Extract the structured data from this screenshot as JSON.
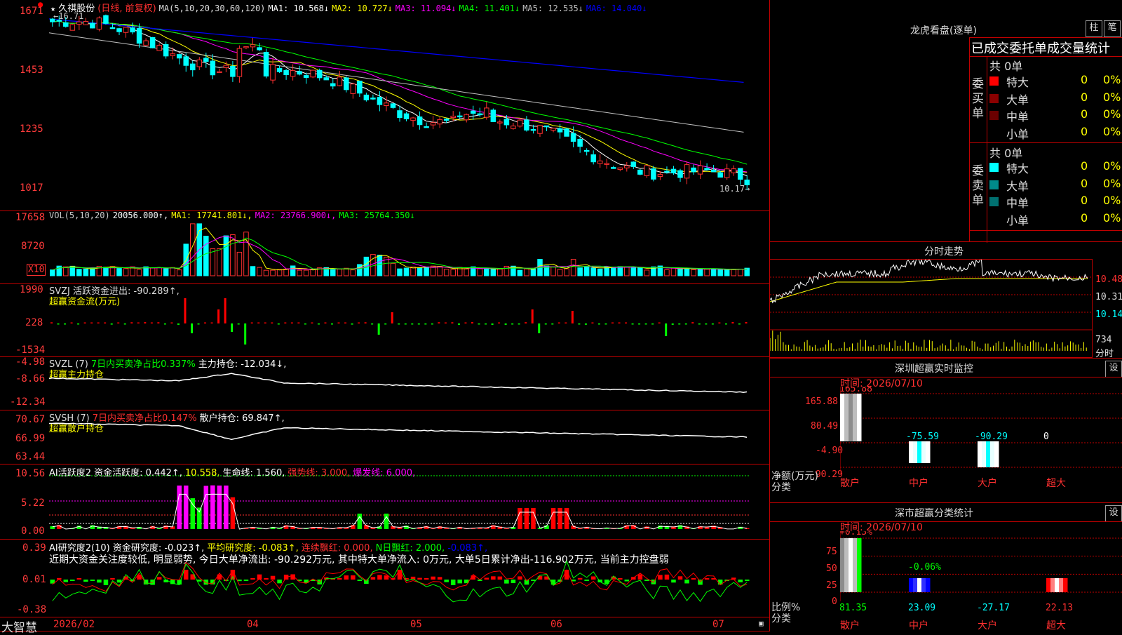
{
  "stock": {
    "name": "久祺股份",
    "period": "(日线, 前复权)",
    "star_icon": "star-icon",
    "high_label": "16.71",
    "low_label": "10.17"
  },
  "ma_legend": {
    "prefix": "MA(5,10,20,30,60,120)",
    "items": [
      {
        "text": "MA1: 10.568↓",
        "color": "#ffffff"
      },
      {
        "text": "MA2: 10.727↓",
        "color": "#ffff00"
      },
      {
        "text": "MA3: 11.094↓",
        "color": "#ff00ff"
      },
      {
        "text": "MA4: 11.401↓",
        "color": "#00ff00"
      },
      {
        "text": "MA5: 12.535↓",
        "color": "#c0c0c0"
      },
      {
        "text": "MA6: 14.040↓",
        "color": "#0000ff"
      }
    ]
  },
  "price_axis": [
    "1671",
    "1453",
    "1235",
    "1017"
  ],
  "vol_legend": {
    "items": [
      {
        "text": "VOL(5,10,20)",
        "color": "#cccccc"
      },
      {
        "text": "20056.000↑,",
        "color": "#ffffff"
      },
      {
        "text": "MA1: 17741.801↓,",
        "color": "#ffff00"
      },
      {
        "text": "MA2: 23766.900↓,",
        "color": "#ff00ff"
      },
      {
        "text": "MA3: 25764.350↓",
        "color": "#00ff00"
      }
    ]
  },
  "vol_axis": [
    "17658",
    "8720",
    "X10"
  ],
  "svzj": {
    "line1": "SVZJ  活跃资金进出: -90.289↑,",
    "line2": "超赢资金流(万元)",
    "axis": [
      "1990",
      "228",
      "-1534"
    ]
  },
  "svzl": {
    "label": "SVZL (7)",
    "green": "7日内买卖净占比0.337%",
    "white": "主力持仓: -12.034↓,",
    "line2": "超赢主力持仓",
    "axis": [
      "-4.98",
      "-8.66",
      "-12.34"
    ]
  },
  "svsh": {
    "label": "SVSH (7)",
    "red": "7日内买卖净占比0.147%",
    "white": "散户持仓: 69.847↑,",
    "line2": "超赢散户持仓",
    "axis": [
      "70.67",
      "66.99",
      "63.44"
    ]
  },
  "ai_active": {
    "prefix": "AI活跃度2 资金活跃度: 0.442↑,",
    "val2": "10.558,",
    "life": "生命线: 1.560,",
    "strong": "强势线: 3.000,",
    "burst": "爆发线: 6.000,",
    "axis": [
      "10.56",
      "5.22",
      "0.00"
    ]
  },
  "ai_research": {
    "prefix": "AI研究度2(10) 资金研究度: -0.023↑,",
    "avg": "平均研究度: -0.083↑,",
    "cont": "连续飘红: 0.000,",
    "nday": "N日飘红: 2.000,",
    "last": "-0.083↑,",
    "summary": "近期大资金关注度较低, 明显弱势, 今日大单净流出: -90.292万元, 其中特大单净流入: 0万元, 大单5日累计净出-116.902万元, 当前主力控盘弱",
    "axis": [
      "0.39",
      "0.01",
      "-0.38"
    ]
  },
  "time_axis": [
    "2026/02",
    "04",
    "05",
    "06",
    "07"
  ],
  "brand": "大智慧",
  "dragon": {
    "title": "龙虎看盘(逐单)",
    "btn1": "柱",
    "btn2": "笔",
    "subtitle": "已成交委托单成交量统计",
    "buy": {
      "label": "委买单",
      "total": "共 0单",
      "rows": [
        {
          "name": "特大",
          "color": "#ff0000",
          "n": "0",
          "pct": "0%"
        },
        {
          "name": "大单",
          "color": "#8b0000",
          "n": "0",
          "pct": "0%"
        },
        {
          "name": "中单",
          "color": "#6a0000",
          "n": "0",
          "pct": "0%"
        },
        {
          "name": "小单",
          "color": "",
          "n": "0",
          "pct": "0%"
        }
      ]
    },
    "sell": {
      "label": "委卖单",
      "total": "共 0单",
      "rows": [
        {
          "name": "特大",
          "color": "#00ffff",
          "n": "0",
          "pct": "0%"
        },
        {
          "name": "大单",
          "color": "#008b8b",
          "n": "0",
          "pct": "0%"
        },
        {
          "name": "中单",
          "color": "#007070",
          "n": "0",
          "pct": "0%"
        },
        {
          "name": "小单",
          "color": "",
          "n": "0",
          "pct": "0%"
        }
      ]
    }
  },
  "intraday": {
    "title": "分时走势",
    "axis": [
      "10.48",
      "10.31",
      "10.14"
    ],
    "vol": "734",
    "unit": "分时"
  },
  "sz_monitor": {
    "title": "深圳超赢实时监控",
    "btn": "设",
    "time": "时间: 2026/07/10",
    "axis": [
      "165.88",
      "80.49",
      "-4.90",
      "-90.29"
    ],
    "ylabel": "净额(万元)",
    "xlabel": "分类",
    "cats": [
      "散户",
      "中户",
      "大户",
      "超大"
    ],
    "values": [
      "165.88",
      "-75.59",
      "-90.29",
      "0"
    ]
  },
  "sz_class": {
    "title": "深市超赢分类统计",
    "btn": "设",
    "time": "时间: 2026/07/10",
    "axis": [
      "75",
      "50",
      "25",
      "0"
    ],
    "ylabel": "比例%",
    "xlabel": "分类",
    "cats": [
      "散户",
      "中户",
      "大户",
      "超大"
    ],
    "top": [
      "+0.13%",
      "-0.06%"
    ],
    "values": [
      "81.35",
      "23.09",
      "-27.17",
      "22.13"
    ]
  },
  "chart_data": [
    {
      "type": "candlestick",
      "title": "久祺股份 (日线, 前复权)",
      "series": [
        {
          "name": "MA1",
          "values": [
            10.568
          ]
        },
        {
          "name": "MA2",
          "values": [
            10.727
          ]
        },
        {
          "name": "MA3",
          "values": [
            11.094
          ]
        },
        {
          "name": "MA4",
          "values": [
            11.401
          ]
        },
        {
          "name": "MA5",
          "values": [
            12.535
          ]
        },
        {
          "name": "MA6",
          "values": [
            14.04
          ]
        }
      ],
      "annotations": [
        "16.71",
        "10.17"
      ],
      "ylim": [
        10.17,
        16.71
      ]
    },
    {
      "type": "bar",
      "title": "VOL(5,10,20)",
      "values": [
        20056.0
      ],
      "series": [
        {
          "name": "MA1",
          "values": [
            17741.801
          ]
        },
        {
          "name": "MA2",
          "values": [
            23766.9
          ]
        },
        {
          "name": "MA3",
          "values": [
            25764.35
          ]
        }
      ]
    },
    {
      "type": "bar",
      "title": "SVZJ 活跃资金进出",
      "values": [
        -90.289
      ],
      "ylim": [
        -1534,
        1990
      ]
    },
    {
      "type": "line",
      "title": "SVZL 主力持仓",
      "values": [
        -12.034
      ],
      "ylim": [
        -12.34,
        -4.98
      ]
    },
    {
      "type": "line",
      "title": "SVSH 散户持仓",
      "values": [
        69.847
      ],
      "ylim": [
        63.44,
        70.67
      ]
    },
    {
      "type": "bar",
      "title": "AI活跃度2",
      "values": [
        0.442
      ],
      "ylim": [
        0,
        10.56
      ]
    },
    {
      "type": "bar",
      "title": "AI研究度2(10)",
      "values": [
        -0.023
      ],
      "ylim": [
        -0.38,
        0.39
      ]
    },
    {
      "type": "bar",
      "title": "深圳超赢实时监控",
      "categories": [
        "散户",
        "中户",
        "大户",
        "超大"
      ],
      "values": [
        165.88,
        -75.59,
        -90.29,
        0
      ],
      "ylim": [
        -90.29,
        165.88
      ]
    },
    {
      "type": "bar",
      "title": "深市超赢分类统计",
      "categories": [
        "散户",
        "中户",
        "大户",
        "超大"
      ],
      "values": [
        81.35,
        23.09,
        -27.17,
        22.13
      ],
      "ylim": [
        0,
        75
      ]
    }
  ]
}
